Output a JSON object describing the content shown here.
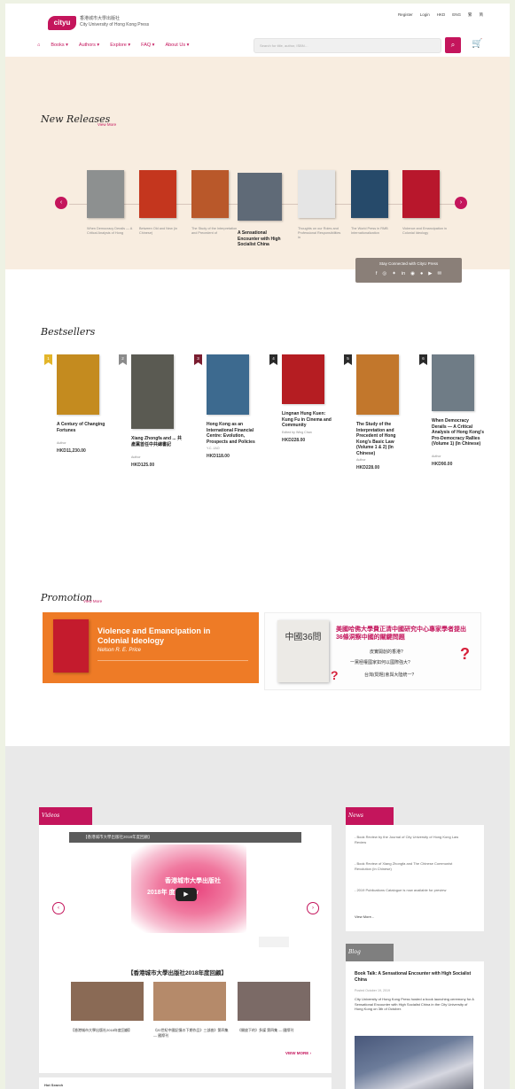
{
  "header": {
    "logo_text": "cityu",
    "brand_zh": "香港城市大學出版社",
    "brand_en": "City University of Hong Kong Press",
    "top_links": [
      "Register",
      "Login",
      "HKD",
      "ENG",
      "繁",
      "简"
    ],
    "search_placeholder": "Search for title, author, ISBN…",
    "nav": [
      "Books",
      "Authors",
      "Explore",
      "FAQ",
      "About Us"
    ]
  },
  "new_releases": {
    "title": "New Releases",
    "view_more": "View More",
    "books": [
      {
        "caption": "When Democracy Derails — A Critical Analysis of Hong",
        "color": "#8d9090"
      },
      {
        "caption": "Between Old and New (in Chinese)",
        "color": "#c4361e"
      },
      {
        "caption": "The Study of the Interpretation and Precedent of",
        "color": "#b9582a"
      },
      {
        "caption": "A Sensational Encounter with High Socialist China",
        "color": "#5f6a77"
      },
      {
        "caption": "Thoughts on our Roles and Professional Responsibilities in",
        "color": "#e5e5e5"
      },
      {
        "caption": "The World Press in RMB Internationalization",
        "color": "#264a6a"
      },
      {
        "caption": "Violence and Emancipation in Colonial Ideology",
        "color": "#b8172c"
      }
    ],
    "stay_connected": "Stay Connected with CityU Press"
  },
  "bestsellers": {
    "title": "Bestsellers",
    "items": [
      {
        "rank": "1",
        "rank_color": "#e3b52a",
        "title": "A Century of Changing Fortunes",
        "author": "Author",
        "price": "HKD11,230.00",
        "color": "#c48b1f"
      },
      {
        "rank": "2",
        "rank_color": "#8b8b8b",
        "title": "Xiang Zhongfa and ... 共產黨首任中共總書記",
        "author": "Author",
        "price": "HKD125.00",
        "color": "#5a5a52"
      },
      {
        "rank": "3",
        "rank_color": "#7a1d30",
        "title": "Hong Kong as an International Financial Centre: Evolution, Prospects and Policies",
        "author": "Y.C. JAO",
        "price": "HKD118.00",
        "color": "#3d6a8f"
      },
      {
        "rank": "4",
        "rank_color": "#2b2b2b",
        "title": "Lingnan Hung Kuen: Kung Fu in Cinema and Community",
        "author": "Edited by Wing Chan",
        "price": "HKD228.00",
        "color": "#b51d22"
      },
      {
        "rank": "5",
        "rank_color": "#2b2b2b",
        "title": "The Study of the Interpretation and Precedent of Hong Kong's Basic Law (Volume 1 & 2) (In Chinese)",
        "author": "Author",
        "price": "HKD228.00",
        "color": "#c2772c"
      },
      {
        "rank": "6",
        "rank_color": "#2b2b2b",
        "title": "When Democracy Derails — A Critical Analysis of Hong Kong's Pro-Democracy Rallies (Volume 1) (In Chinese)",
        "author": "Author",
        "price": "HKD90.00",
        "color": "#6f7c86"
      }
    ]
  },
  "promotion": {
    "title": "Promotion",
    "view_more": "View More",
    "banner1_title": "Violence and Emancipation in Colonial Ideology",
    "banner1_author": "Nelson R. E. Price",
    "banner2_heading": "美國哈佛大學費正清中國研究中心專家學者提出36條洞察中國的關鍵問題",
    "banner2_book": "中國36問",
    "banner2_q1": "皮實開創的香港?",
    "banner2_q2": "一黨極權國家如何以國際強大?",
    "banner2_q3": "台灣(問題)會與大陸統一?"
  },
  "videos": {
    "title": "Videos",
    "video_title": "【香港城市大學出版社2018年度回顧】",
    "splash_line1": "香港城市大學出版社",
    "splash_line2": "2018年 度 Review",
    "caption": "【香港城市大學出版社2018年度回顧】",
    "thumbs": [
      {
        "caption": "【香港城市大學出版社2018年度回顧】",
        "color": "#8a6a55"
      },
      {
        "caption": "《20世紀中國記憶の下期作品》三部曲》第四集 — 國際刊",
        "color": "#b58a6a"
      },
      {
        "caption": "《開放下的》多媒 第四集 — 國際刊",
        "color": "#7b6a66"
      }
    ],
    "view_more": "VIEW MORE"
  },
  "news": {
    "title": "News",
    "items": [
      "- Book Review by the Journal of City University of Hong Kong Law Review",
      "- Book Review of Xiang Zhongfa and The Chinese Communist Revolution (In Chinese)",
      "- 2019 Publications Catalogue is now available for preview"
    ],
    "view_more": "View More..."
  },
  "blog": {
    "title": "Blog",
    "post_title": "Book Talk: A Sensational Encounter with High Socialist China",
    "post_date": "Posted October 19, 2019",
    "post_body": "City University of Hong Kong Press hosted a book launching ceremony for A Sensational Encounter with High Socialist China in the City University of Hong Kong on 3th of October."
  },
  "hot_search": {
    "title": "Hot Search"
  }
}
